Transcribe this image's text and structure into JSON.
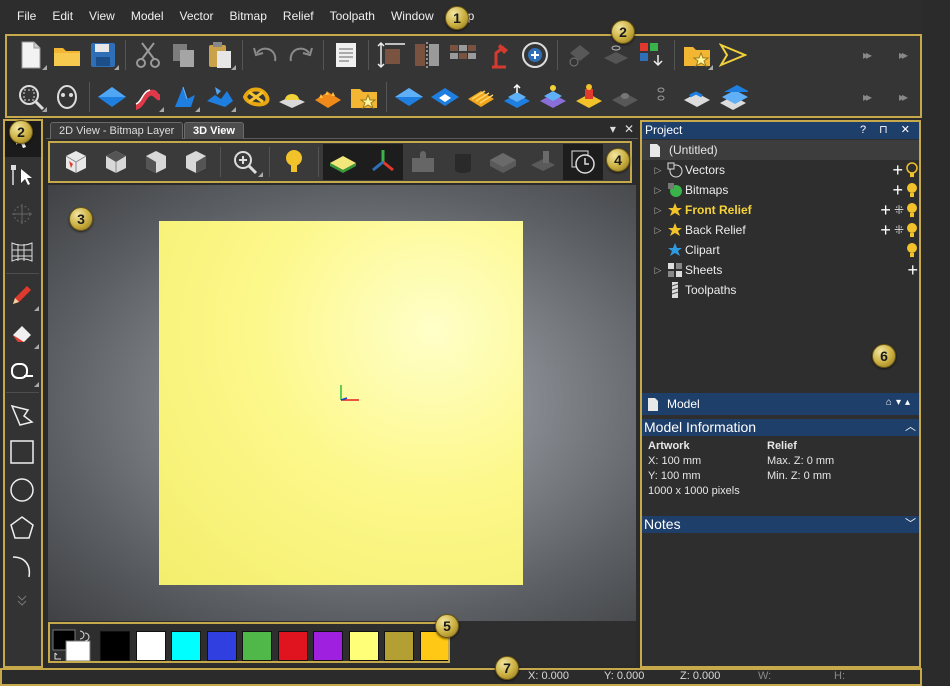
{
  "menu": [
    "File",
    "Edit",
    "View",
    "Model",
    "Vector",
    "Bitmap",
    "Relief",
    "Toolpath",
    "Window",
    "Help"
  ],
  "callouts": [
    "1",
    "2",
    "2",
    "3",
    "4",
    "5",
    "6",
    "7"
  ],
  "view": {
    "tabs": [
      "2D View - Bitmap Layer",
      "3D View"
    ],
    "controls": {
      "pin": "▾",
      "close": "✕"
    }
  },
  "palette": {
    "colors": [
      "#000000",
      "#ffffff",
      "#00ffff",
      "#3040e0",
      "#50b848",
      "#e0141e",
      "#a020e0",
      "#ffff78",
      "#b4a032",
      "#ffc814"
    ]
  },
  "project": {
    "title": "Project",
    "title_ctrls": "? ⊓ ✕",
    "root": "(Untitled)",
    "items": [
      {
        "label": "Vectors",
        "bold": false
      },
      {
        "label": "Bitmaps",
        "bold": false
      },
      {
        "label": "Front Relief",
        "bold": true
      },
      {
        "label": "Back Relief",
        "bold": false
      },
      {
        "label": "Clipart",
        "bold": false
      },
      {
        "label": "Sheets",
        "bold": false
      },
      {
        "label": "Toolpaths",
        "bold": false
      }
    ]
  },
  "model": {
    "title": "Model",
    "section_title": "Model Information",
    "artwork_heading": "Artwork",
    "relief_heading": "Relief",
    "artwork_x": "X: 100 mm",
    "artwork_y": "Y: 100 mm",
    "pixels": "1000 x 1000 pixels",
    "max_z": "Max. Z: 0 mm",
    "min_z": "Min. Z: 0 mm",
    "notes_title": "Notes"
  },
  "status": {
    "x": "X: 0.000",
    "y": "Y: 0.000",
    "z": "Z: 0.000",
    "w": "W:",
    "h": "H:"
  }
}
